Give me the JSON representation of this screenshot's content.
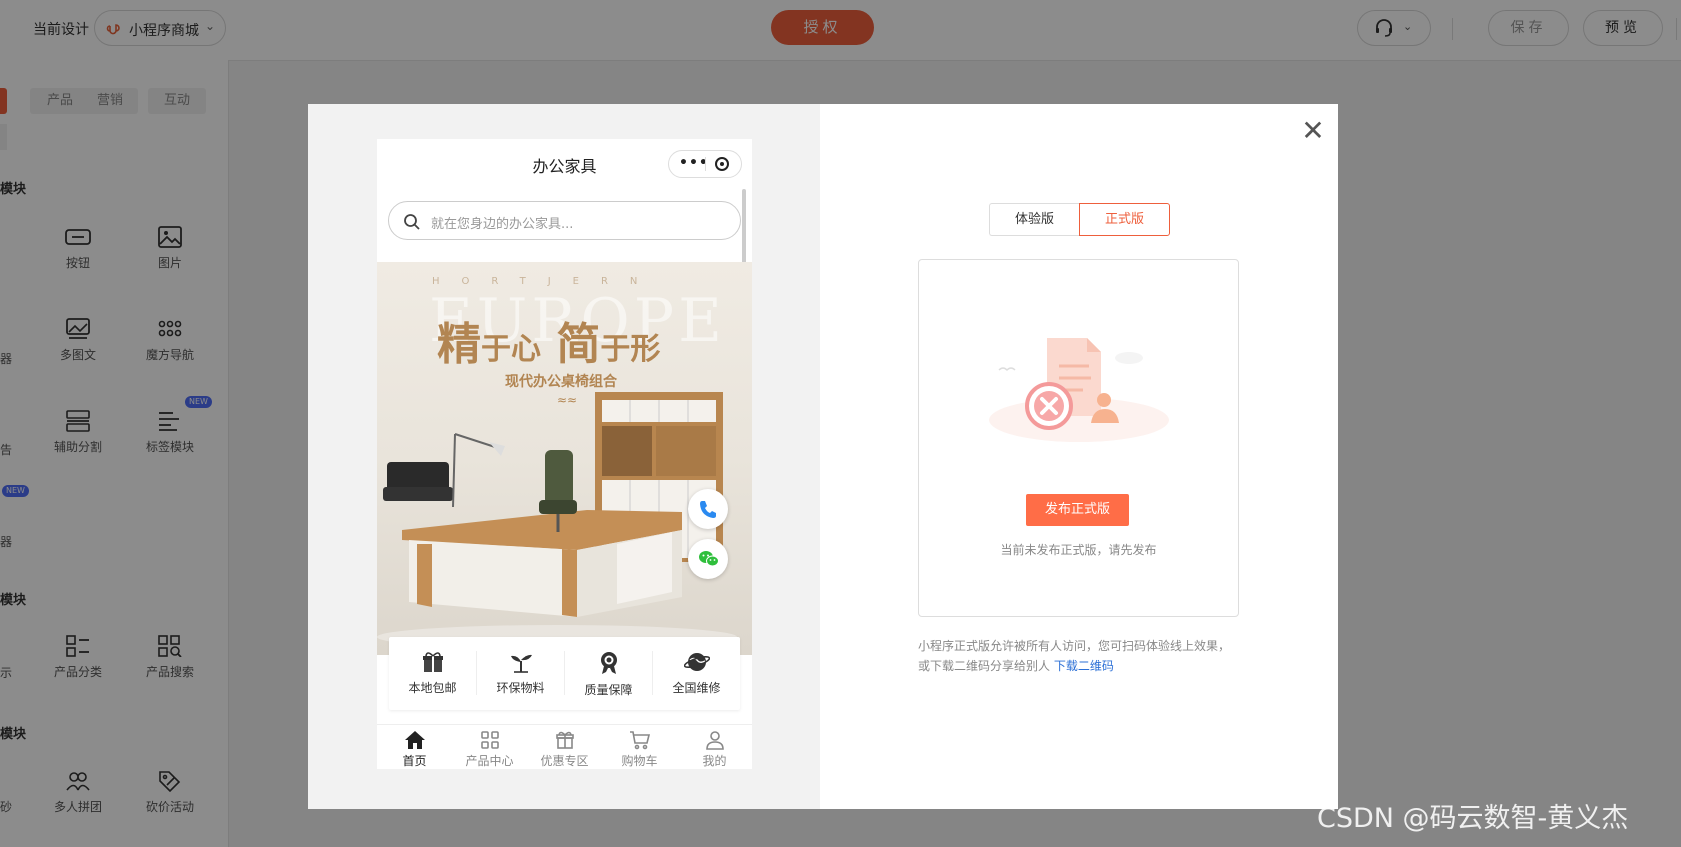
{
  "topbar": {
    "current_design_label": "当前设计",
    "project_select": "小程序商城",
    "auth_button": "授权",
    "save_button": "保存",
    "preview_button": "预览"
  },
  "left_panel": {
    "tabs": [
      "产品",
      "营销",
      "互动"
    ],
    "sections": [
      "模块",
      "模块",
      "模块"
    ],
    "components": [
      {
        "label": "按钮",
        "icon": "button-icon"
      },
      {
        "label": "图片",
        "icon": "image-icon"
      },
      {
        "label": "多图文",
        "icon": "multi-image-icon"
      },
      {
        "label": "魔方导航",
        "icon": "grid-dots-icon"
      },
      {
        "label": "辅助分割",
        "icon": "divider-icon"
      },
      {
        "label": "标签模块",
        "icon": "tag-list-icon",
        "badge": "NEW"
      },
      {
        "label": "产品分类",
        "icon": "category-icon"
      },
      {
        "label": "产品搜索",
        "icon": "product-search-icon"
      },
      {
        "label": "多人拼团",
        "icon": "group-buy-icon"
      },
      {
        "label": "砍价活动",
        "icon": "bargain-icon"
      }
    ],
    "partial_labels": [
      "器",
      "告",
      "器",
      "示",
      "砂"
    ],
    "new_badge": "NEW"
  },
  "phone": {
    "title": "办公家具",
    "search_placeholder": "就在您身边的办公家具...",
    "banner": {
      "watermark": "HORTJERN",
      "bg_word": "EUROPE",
      "headline_a": "精",
      "headline_b": "于心",
      "headline_c": "简",
      "headline_d": "于形",
      "subtitle": "现代办公桌椅组合",
      "waves": "≈≈"
    },
    "features": [
      {
        "label": "本地包邮",
        "icon": "gift-icon"
      },
      {
        "label": "环保物料",
        "icon": "sprout-icon"
      },
      {
        "label": "质量保障",
        "icon": "medal-icon"
      },
      {
        "label": "全国维修",
        "icon": "globe-icon"
      }
    ],
    "tabbar": [
      {
        "label": "首页",
        "icon": "home-icon",
        "active": true
      },
      {
        "label": "产品中心",
        "icon": "grid-icon"
      },
      {
        "label": "优惠专区",
        "icon": "gift-icon"
      },
      {
        "label": "购物车",
        "icon": "cart-icon"
      },
      {
        "label": "我的",
        "icon": "user-icon"
      }
    ]
  },
  "modal": {
    "trial_tab": "体验版",
    "official_tab": "正式版",
    "publish_button": "发布正式版",
    "publish_tip": "当前未发布正式版，请先发布",
    "description": "小程序正式版允许被所有人访问，您可扫码体验线上效果，或下载二维码分享给别人",
    "download_link": "下载二维码"
  },
  "watermark": "CSDN @码云数智-黄义杰",
  "colors": {
    "accent": "#ee5f3c",
    "publish": "#ff6d47",
    "link": "#2b6fd6"
  }
}
